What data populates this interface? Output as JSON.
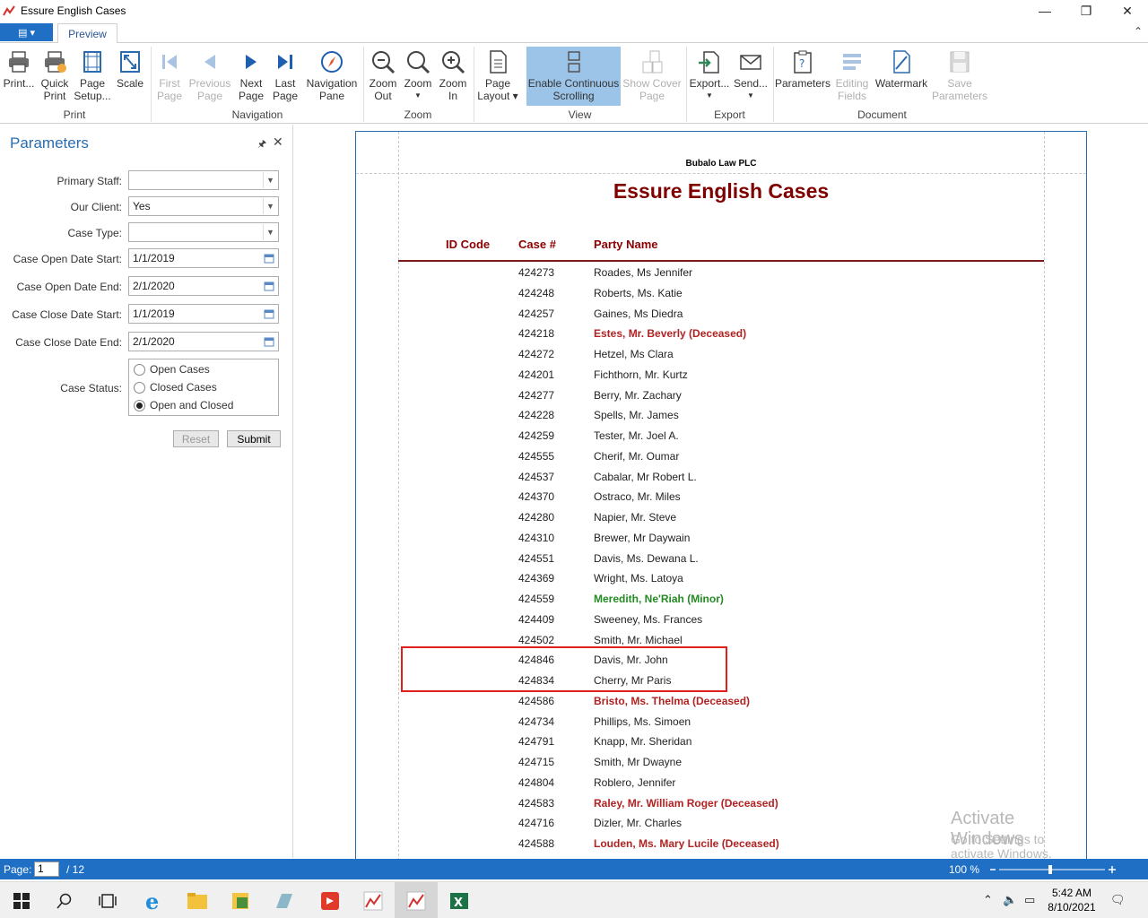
{
  "window": {
    "title": "Essure English Cases",
    "minimize": "—",
    "restore": "❐",
    "close": "✕"
  },
  "ribbon": {
    "file_tab": "▤ ▾",
    "tabs": [
      {
        "label": "Preview"
      }
    ],
    "collapse": "⌃",
    "buttons": {
      "print": "Print...",
      "quick_print": "Quick\nPrint",
      "page_setup": "Page\nSetup...",
      "scale": "Scale",
      "first_page": "First\nPage",
      "previous_page": "Previous\nPage",
      "next_page": "Next\nPage",
      "last_page": "Last\nPage",
      "navigation_pane": "Navigation\nPane",
      "zoom_out": "Zoom\nOut",
      "zoom": "Zoom",
      "zoom_in": "Zoom\nIn",
      "page_layout": "Page\nLayout",
      "continuous_scrolling": "Enable Continuous\nScrolling",
      "show_cover_page": "Show Cover\nPage",
      "export": "Export...",
      "send": "Send...",
      "parameters": "Parameters",
      "editing_fields": "Editing\nFields",
      "watermark": "Watermark",
      "save_parameters": "Save\nParameters"
    },
    "groups": {
      "print": "Print",
      "navigation": "Navigation",
      "zoom": "Zoom",
      "view": "View",
      "export": "Export",
      "document": "Document"
    }
  },
  "parameters_panel": {
    "title": "Parameters",
    "pin": "🖈",
    "close": "✕",
    "fields": {
      "primary_staff": {
        "label": "Primary Staff:",
        "value": ""
      },
      "our_client": {
        "label": "Our Client:",
        "value": "Yes"
      },
      "case_type": {
        "label": "Case Type:",
        "value": ""
      },
      "case_open_date_start": {
        "label": "Case Open Date Start:",
        "value": "1/1/2019"
      },
      "case_open_date_end": {
        "label": "Case Open Date End:",
        "value": "2/1/2020"
      },
      "case_close_date_start": {
        "label": "Case Close Date Start:",
        "value": "1/1/2019"
      },
      "case_close_date_end": {
        "label": "Case Close Date End:",
        "value": "2/1/2020"
      }
    },
    "case_status": {
      "label": "Case Status:",
      "options": [
        "Open Cases",
        "Closed Cases",
        "Open and Closed"
      ],
      "selected": "Open and Closed"
    },
    "reset_label": "Reset",
    "submit_label": "Submit"
  },
  "report": {
    "firm": "Bubalo Law PLC",
    "title": "Essure English Cases",
    "columns": {
      "id_code": "ID Code",
      "case": "Case #",
      "party": "Party Name"
    },
    "rows": [
      {
        "case": "424273",
        "party": "Roades, Ms Jennifer",
        "status": "normal"
      },
      {
        "case": "424248",
        "party": "Roberts, Ms. Katie",
        "status": "normal"
      },
      {
        "case": "424257",
        "party": "Gaines, Ms Diedra",
        "status": "normal"
      },
      {
        "case": "424218",
        "party": "Estes, Mr. Beverly (Deceased)",
        "status": "deceased"
      },
      {
        "case": "424272",
        "party": "Hetzel, Ms Clara",
        "status": "normal"
      },
      {
        "case": "424201",
        "party": "Fichthorn, Mr. Kurtz",
        "status": "normal"
      },
      {
        "case": "424277",
        "party": "Berry, Mr. Zachary",
        "status": "normal"
      },
      {
        "case": "424228",
        "party": "Spells, Mr. James",
        "status": "normal"
      },
      {
        "case": "424259",
        "party": "Tester, Mr. Joel A.",
        "status": "normal"
      },
      {
        "case": "424555",
        "party": "Cherif, Mr. Oumar",
        "status": "normal"
      },
      {
        "case": "424537",
        "party": "Cabalar, Mr Robert L.",
        "status": "normal"
      },
      {
        "case": "424370",
        "party": "Ostraco, Mr. Miles",
        "status": "normal"
      },
      {
        "case": "424280",
        "party": "Napier, Mr. Steve",
        "status": "normal"
      },
      {
        "case": "424310",
        "party": "Brewer, Mr Daywain",
        "status": "normal"
      },
      {
        "case": "424551",
        "party": "Davis, Ms. Dewana L.",
        "status": "normal"
      },
      {
        "case": "424369",
        "party": "Wright, Ms. Latoya",
        "status": "normal"
      },
      {
        "case": "424559",
        "party": "Meredith, Ne'Riah (Minor)",
        "status": "minor"
      },
      {
        "case": "424409",
        "party": "Sweeney, Ms. Frances",
        "status": "normal"
      },
      {
        "case": "424502",
        "party": "Smith, Mr. Michael",
        "status": "normal"
      },
      {
        "case": "424846",
        "party": "Davis, Mr. John",
        "status": "normal"
      },
      {
        "case": "424834",
        "party": "Cherry, Mr Paris",
        "status": "normal"
      },
      {
        "case": "424586",
        "party": "Bristo, Ms. Thelma (Deceased)",
        "status": "deceased"
      },
      {
        "case": "424734",
        "party": "Phillips, Ms. Simoen",
        "status": "normal"
      },
      {
        "case": "424791",
        "party": "Knapp, Mr. Sheridan",
        "status": "normal"
      },
      {
        "case": "424715",
        "party": "Smith, Mr Dwayne",
        "status": "normal"
      },
      {
        "case": "424804",
        "party": "Roblero, Jennifer",
        "status": "normal"
      },
      {
        "case": "424583",
        "party": "Raley, Mr. William Roger (Deceased)",
        "status": "deceased"
      },
      {
        "case": "424716",
        "party": "Dizler, Mr. Charles",
        "status": "normal"
      },
      {
        "case": "424588",
        "party": "Louden, Ms. Mary Lucile (Deceased)",
        "status": "deceased"
      }
    ]
  },
  "activation_watermark": {
    "line1": "Activate Windows",
    "line2": "Go to Settings to activate Windows."
  },
  "statusbar": {
    "page_label": "Page:",
    "current_page": "1",
    "total_pages": "/ 12",
    "zoom": "100 %"
  },
  "taskbar": {
    "time": "5:42 AM",
    "date": "8/10/2021"
  },
  "colors": {
    "accent": "#1f6fc5",
    "title_red": "#800000",
    "deceased": "#b22222",
    "minor": "#228b22",
    "highlight": "#e0201a"
  }
}
